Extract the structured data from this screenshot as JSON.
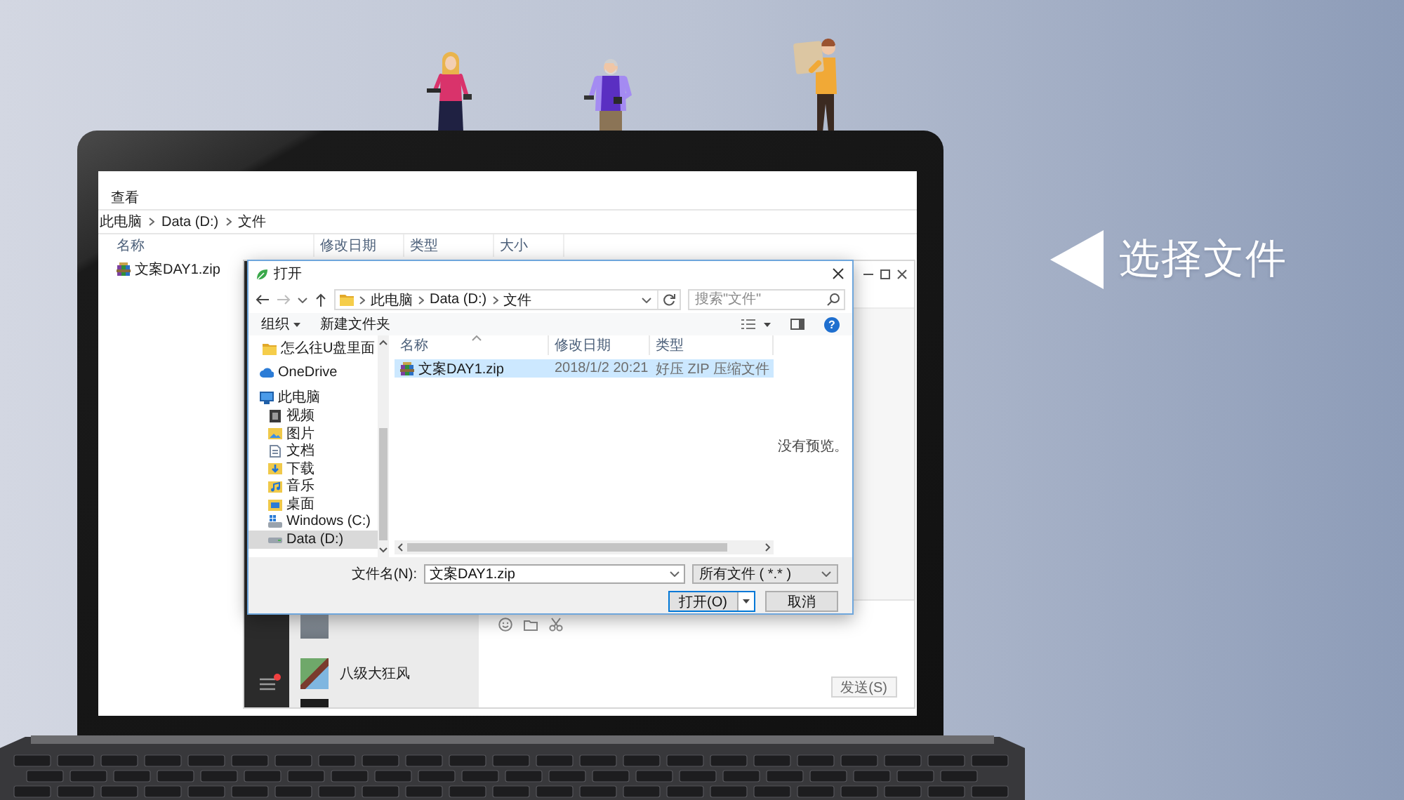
{
  "caption": {
    "text": "选择文件"
  },
  "explorer": {
    "ribbon_tab": "查看",
    "breadcrumb": [
      "此电脑",
      "Data (D:)",
      "文件"
    ],
    "columns": [
      "名称",
      "修改日期",
      "类型",
      "大小"
    ],
    "files": [
      {
        "name": "文案DAY1.zip"
      }
    ]
  },
  "chat_app": {
    "menu": {
      "unread": true
    },
    "contacts": [
      {
        "kind": "covered"
      },
      {
        "kind": "full",
        "name": "八级大狂风"
      },
      {
        "kind": "clipped"
      }
    ],
    "send_button": "发送(S)"
  },
  "dialog": {
    "title": "打开",
    "address": [
      "此电脑",
      "Data (D:)",
      "文件"
    ],
    "search": {
      "placeholder": "搜索\"文件\""
    },
    "toolbar": {
      "organize": "组织",
      "new_folder": "新建文件夹",
      "help": "?"
    },
    "nav": [
      {
        "kind": "folder",
        "label": "怎么往U盘里面",
        "selected": false
      },
      {
        "kind": "cloud",
        "label": "OneDrive",
        "selected": false
      },
      {
        "kind": "computer",
        "label": "此电脑",
        "selected": false,
        "children": [
          {
            "kind": "video",
            "label": "视频",
            "selected": false
          },
          {
            "kind": "pictures",
            "label": "图片",
            "selected": false
          },
          {
            "kind": "documents",
            "label": "文档",
            "selected": false
          },
          {
            "kind": "downloads",
            "label": "下载",
            "selected": false
          },
          {
            "kind": "music",
            "label": "音乐",
            "selected": false
          },
          {
            "kind": "desktop",
            "label": "桌面",
            "selected": false
          },
          {
            "kind": "system_drive",
            "label": "Windows (C:)",
            "selected": false
          },
          {
            "kind": "drive",
            "label": "Data (D:)",
            "selected": true
          }
        ]
      }
    ],
    "columns": [
      "名称",
      "修改日期",
      "类型"
    ],
    "files": [
      {
        "name": "文案DAY1.zip",
        "modified": "2018/1/2 20:21",
        "type": "好压 ZIP 压缩文件",
        "selected": true
      }
    ],
    "preview": "没有预览。",
    "filename": {
      "label": "文件名(N):",
      "value": "文案DAY1.zip"
    },
    "filter": "所有文件 ( *.* )",
    "buttons": [
      {
        "kind": "split",
        "label": "打开(O)"
      },
      {
        "kind": "plain",
        "label": "取消"
      }
    ]
  }
}
